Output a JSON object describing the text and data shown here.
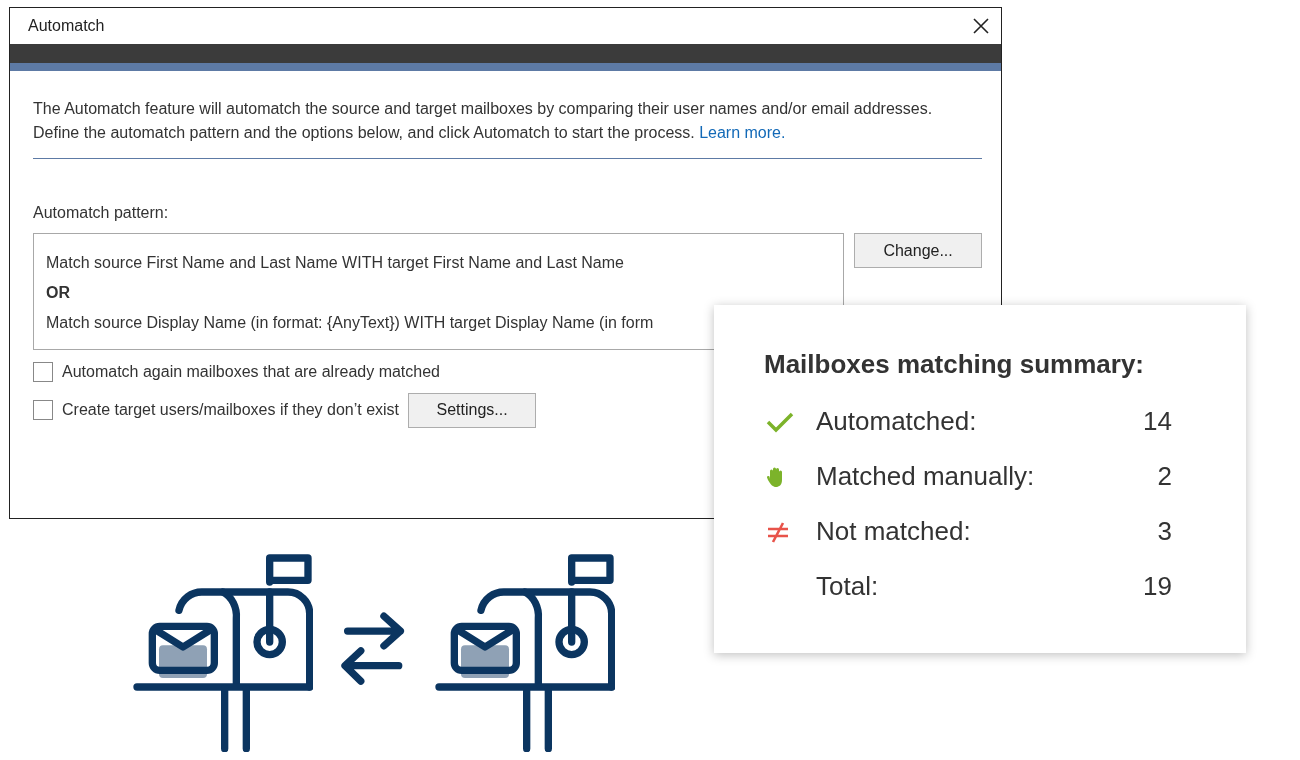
{
  "window": {
    "title": "Automatch"
  },
  "description": {
    "text": "The Automatch feature will automatch the source and target mailboxes by comparing their user names and/or email addresses. Define the automatch pattern and the options below, and click Automatch to start the process.",
    "link": "Learn more."
  },
  "pattern": {
    "label": "Automatch pattern:",
    "button": "Change...",
    "lines": [
      {
        "kind": "rule",
        "text": "Match source First Name and Last Name WITH target First Name and Last Name"
      },
      {
        "kind": "operator",
        "text": "OR"
      },
      {
        "kind": "rule",
        "text": "Match source Display Name (in format: {AnyText}) WITH target Display Name (in form"
      }
    ]
  },
  "options": [
    {
      "label": "Automatch again mailboxes that are already matched",
      "checked": false
    },
    {
      "label": "Create target users/mailboxes if they don’t exist",
      "checked": false,
      "button": "Settings..."
    }
  ],
  "summary": {
    "title": "Mailboxes matching summary:",
    "rows": [
      {
        "kind": "automatched",
        "label": "Automatched:",
        "value": "14"
      },
      {
        "kind": "manual",
        "label": "Matched manually:",
        "value": "2"
      },
      {
        "kind": "unmatched",
        "label": "Not matched:",
        "value": "3"
      },
      {
        "kind": "total",
        "label": "Total:",
        "value": "19"
      }
    ]
  }
}
